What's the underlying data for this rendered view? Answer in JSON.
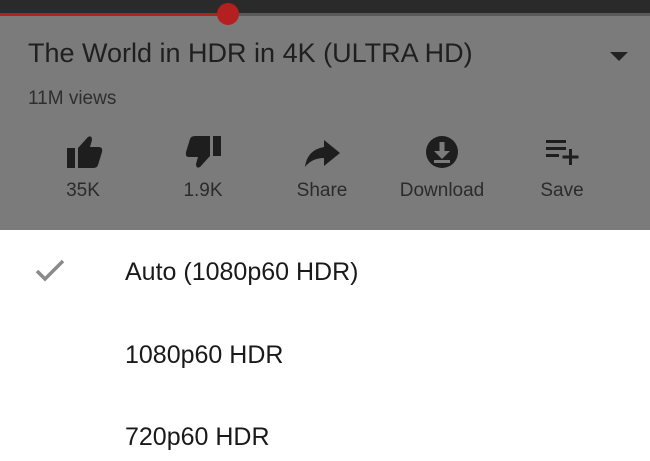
{
  "video": {
    "title": "The World in HDR in 4K (ULTRA HD)",
    "views": "11M views",
    "progress_fraction": 0.35
  },
  "actions": [
    {
      "icon": "thumbs-up-icon",
      "label": "35K"
    },
    {
      "icon": "thumbs-down-icon",
      "label": "1.9K"
    },
    {
      "icon": "share-icon",
      "label": "Share"
    },
    {
      "icon": "download-icon",
      "label": "Download"
    },
    {
      "icon": "playlist-add-icon",
      "label": "Save"
    }
  ],
  "quality_menu": {
    "options": [
      {
        "label": "Auto (1080p60 HDR)",
        "selected": true
      },
      {
        "label": "1080p60 HDR",
        "selected": false
      },
      {
        "label": "720p60 HDR",
        "selected": false
      }
    ]
  },
  "colors": {
    "accent": "#b3201f",
    "dim_overlay": "#7b7b7b",
    "sheet": "#ffffff",
    "check": "#8a8a8a"
  }
}
